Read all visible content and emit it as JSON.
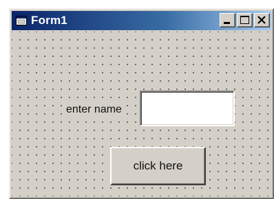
{
  "window": {
    "title": "Form1",
    "icon": "form-app-icon",
    "caption_buttons": [
      "minimize-icon",
      "maximize-icon",
      "close-icon"
    ]
  },
  "form": {
    "label_text": "enter name",
    "textbox_value": "",
    "button_label": "click here"
  },
  "colors": {
    "title_start": "#0a246a",
    "title_end": "#a6caf0",
    "face": "#d4d0c8"
  }
}
